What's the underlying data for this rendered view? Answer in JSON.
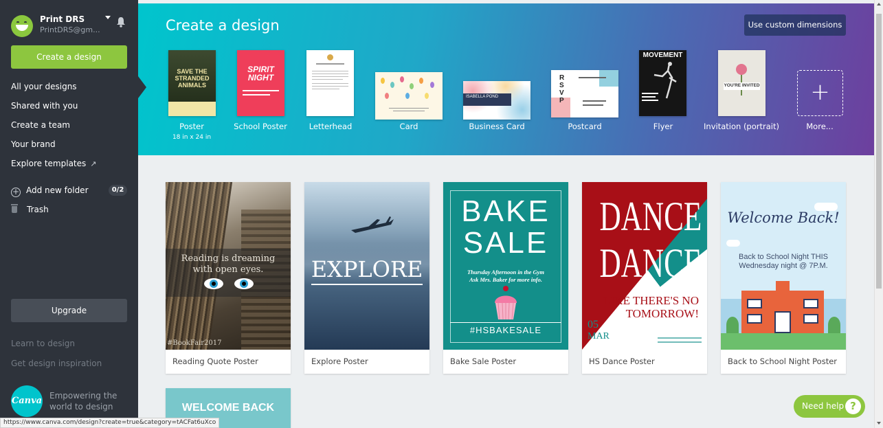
{
  "sidebar": {
    "profile": {
      "name": "Print DRS",
      "email": "PrintDRS@gm..."
    },
    "create_button": "Create a design",
    "nav": [
      {
        "label": "All your designs"
      },
      {
        "label": "Shared with you"
      },
      {
        "label": "Create a team"
      },
      {
        "label": "Your brand"
      },
      {
        "label": "Explore templates"
      }
    ],
    "add_folder": "Add new folder",
    "folder_count": "0/2",
    "trash": "Trash",
    "upgrade": "Upgrade",
    "learn": "Learn to design",
    "inspiration": "Get design inspiration",
    "logo_text": "Canva",
    "tagline": "Empowering the world to design"
  },
  "header": {
    "title": "Create a design",
    "custom_button": "Use custom dimensions",
    "templates": [
      {
        "label": "Poster",
        "sub": "18 in x 24 in",
        "thumb_text": "SAVE THE STRANDED ANIMALS"
      },
      {
        "label": "School Poster",
        "thumb_text": "SPIRIT NIGHT"
      },
      {
        "label": "Letterhead"
      },
      {
        "label": "Card"
      },
      {
        "label": "Business Card",
        "thumb_text": "ISABELLA POND"
      },
      {
        "label": "Postcard",
        "thumb_text": "RSVP"
      },
      {
        "label": "Flyer",
        "thumb_text": "MOVEMENT"
      },
      {
        "label": "Invitation (portrait)",
        "thumb_text": "YOU'RE INVITED"
      },
      {
        "label": "More..."
      }
    ]
  },
  "cards": [
    {
      "caption": "Reading Quote Poster",
      "text1": "Reading is dreaming",
      "text2": "with open eyes.",
      "tag": "#BookFair2017"
    },
    {
      "caption": "Explore Poster",
      "text1": "EXPLORE"
    },
    {
      "caption": "Bake Sale Poster",
      "text1": "BAKE",
      "text2": "SALE",
      "text3": "Thursday Afternoon in the Gym",
      "text4": "Ask Mrs. Baker for more info.",
      "tag": "#HSBAKESALE"
    },
    {
      "caption": "HS Dance Poster",
      "text1": "DANCE",
      "text2": "DANCE",
      "text3": "LIKE THERE'S NO",
      "text4": "TOMORROW!",
      "date1": "05",
      "date2": "MAR"
    },
    {
      "caption": "Back to School Night Poster",
      "text1": "Welcome Back!",
      "text2": "Back to School Night THIS",
      "text3": "Wednesday night @ 7P.M."
    }
  ],
  "partial_card": {
    "text": "WELCOME BACK"
  },
  "help_button": "Need help",
  "status_url": "https://www.canva.com/design?create=true&category=tACFat6uXco",
  "colors": {
    "brand_green": "#8dc63f",
    "sidebar": "#2e333b",
    "header_start": "#00c5cd",
    "header_end": "#6d3f9e"
  }
}
